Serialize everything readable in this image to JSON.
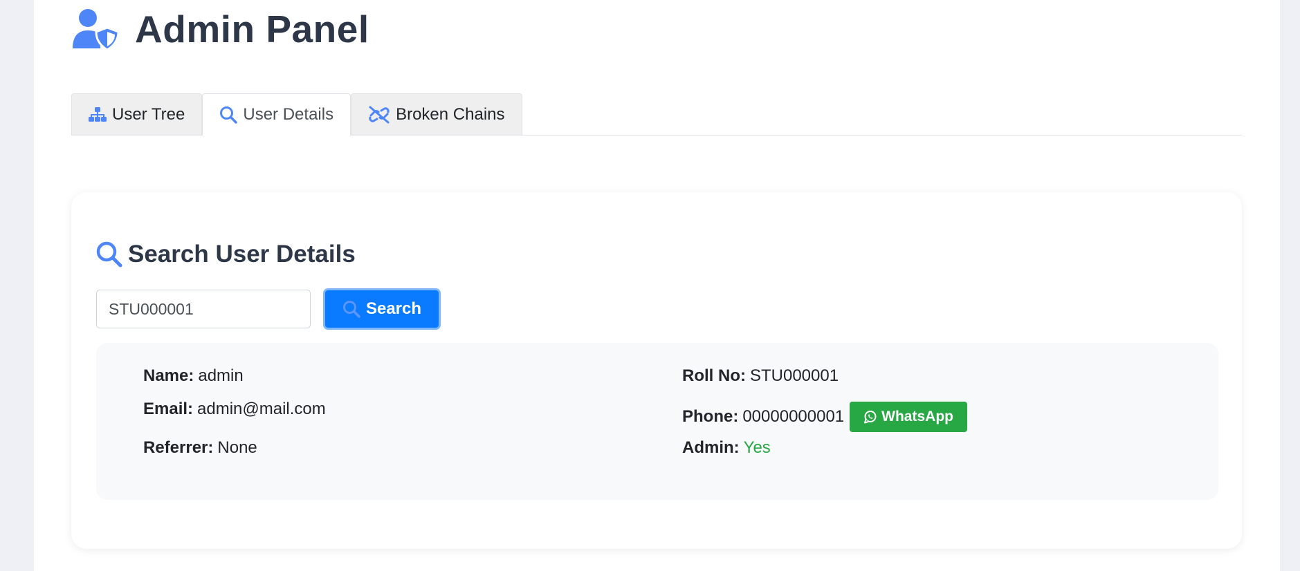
{
  "header": {
    "title": "Admin Panel",
    "icon": "user-shield-icon",
    "accent": "#4f86f7"
  },
  "tabs": [
    {
      "label": "User Tree",
      "icon": "sitemap-icon",
      "active": false
    },
    {
      "label": "User Details",
      "icon": "search-icon",
      "active": true
    },
    {
      "label": "Broken Chains",
      "icon": "unlink-icon",
      "active": false
    }
  ],
  "search": {
    "title": "Search User Details",
    "input_value": "STU000001",
    "button_label": "Search"
  },
  "details": {
    "name": {
      "label": "Name:",
      "value": "admin"
    },
    "email": {
      "label": "Email:",
      "value": "admin@mail.com"
    },
    "referrer": {
      "label": "Referrer:",
      "value": "None"
    },
    "roll_no": {
      "label": "Roll No:",
      "value": "STU000001"
    },
    "phone": {
      "label": "Phone:",
      "value": "00000000001"
    },
    "whatsapp_label": "WhatsApp",
    "admin": {
      "label": "Admin:",
      "value": "Yes"
    }
  },
  "colors": {
    "primary": "#0a7bff",
    "success": "#28a745",
    "heading": "#2d3748"
  }
}
